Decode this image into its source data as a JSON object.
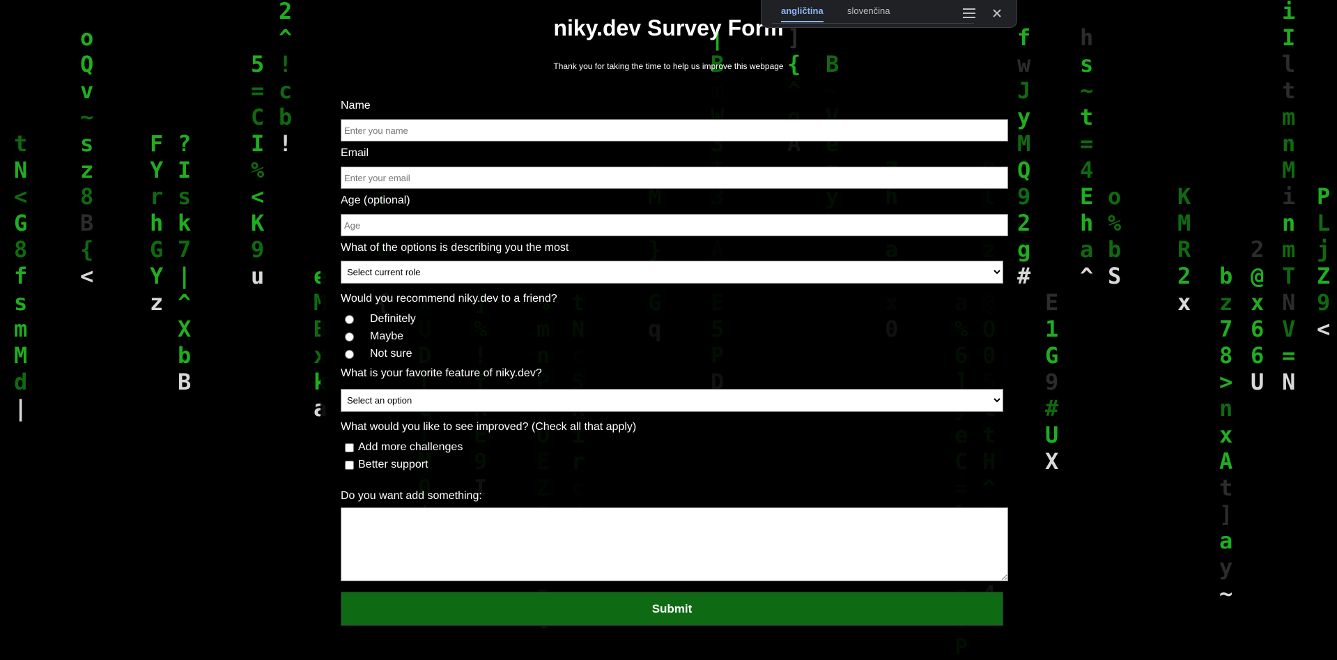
{
  "page": {
    "title": "niky.dev Survey Form",
    "subtitle": "Thank you for taking the time to help us improve this webpage"
  },
  "translate_bar": {
    "languages": [
      "angličtina",
      "slovenčina"
    ],
    "active_language": "angličtina",
    "menu_icon": "hamburger-menu-icon",
    "close_icon": "close-icon"
  },
  "form": {
    "name": {
      "label": "Name",
      "placeholder": "Enter you name",
      "value": ""
    },
    "email": {
      "label": "Email",
      "placeholder": "Enter your email",
      "value": ""
    },
    "age": {
      "label": "Age (optional)",
      "placeholder": "Age",
      "value": ""
    },
    "role": {
      "label": "What of the options is describing you the most",
      "selected": "Select current role"
    },
    "recommend": {
      "label": "Would you recommend niky.dev to a friend?",
      "options": [
        "Definitely",
        "Maybe",
        "Not sure"
      ]
    },
    "feature": {
      "label": "What is your favorite feature of niky.dev?",
      "selected": "Select an option"
    },
    "improve": {
      "label": "What would you like to see improved?  (Check all that apply)",
      "options": [
        "Add more challenges",
        "Better support"
      ]
    },
    "comments": {
      "label": "Do you want add something:",
      "value": ""
    },
    "submit_label": "Submit"
  },
  "colors": {
    "background": "#000000",
    "matrix_green": "#1fae1f",
    "submit_green": "#0f6a14",
    "translate_accent": "#8ab4f8"
  }
}
